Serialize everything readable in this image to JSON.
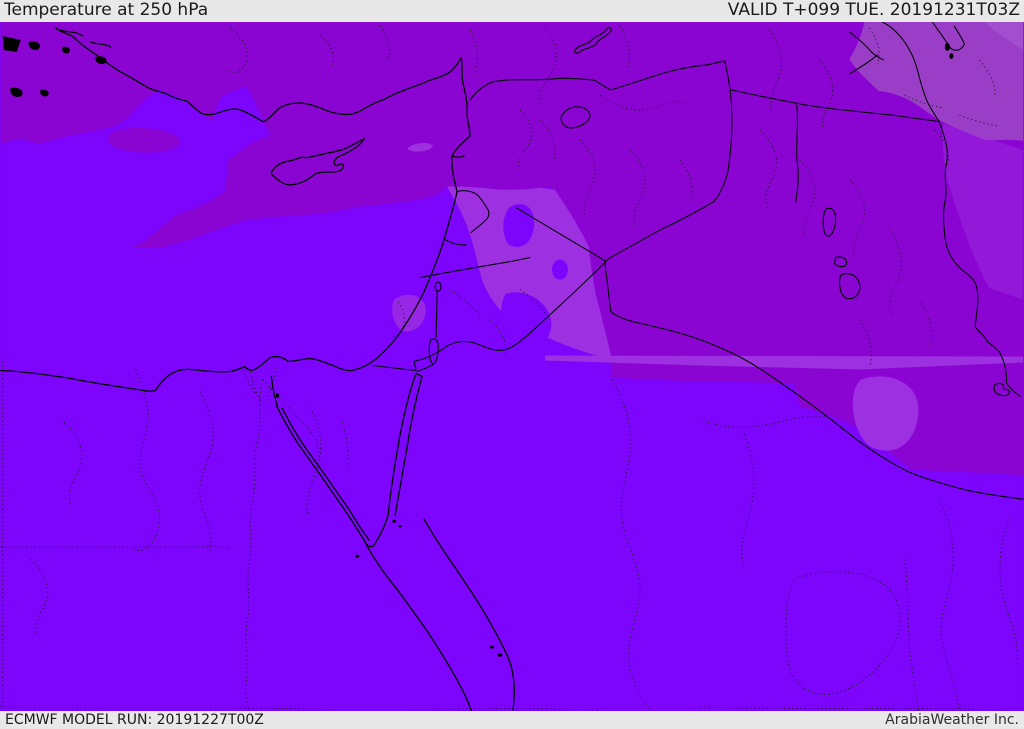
{
  "header": {
    "title": "Temperature at 250 hPa",
    "valid_label": "VALID T+099 TUE. 20191231T03Z"
  },
  "footer": {
    "model_run": "ECMWF MODEL RUN: 20191227T00Z",
    "brand": "ArabiaWeather Inc."
  },
  "map": {
    "description": "Temperature shading map of the Middle East region",
    "colors": {
      "barbg": "#e8e8e8",
      "bartext": "#1a1a1a",
      "base": "#7d05fb",
      "band": "#8a05d2",
      "light": "#9d30e0",
      "muted": "#9a3ec8",
      "mutedlight": "#a85cd6",
      "line": "#000000"
    }
  }
}
